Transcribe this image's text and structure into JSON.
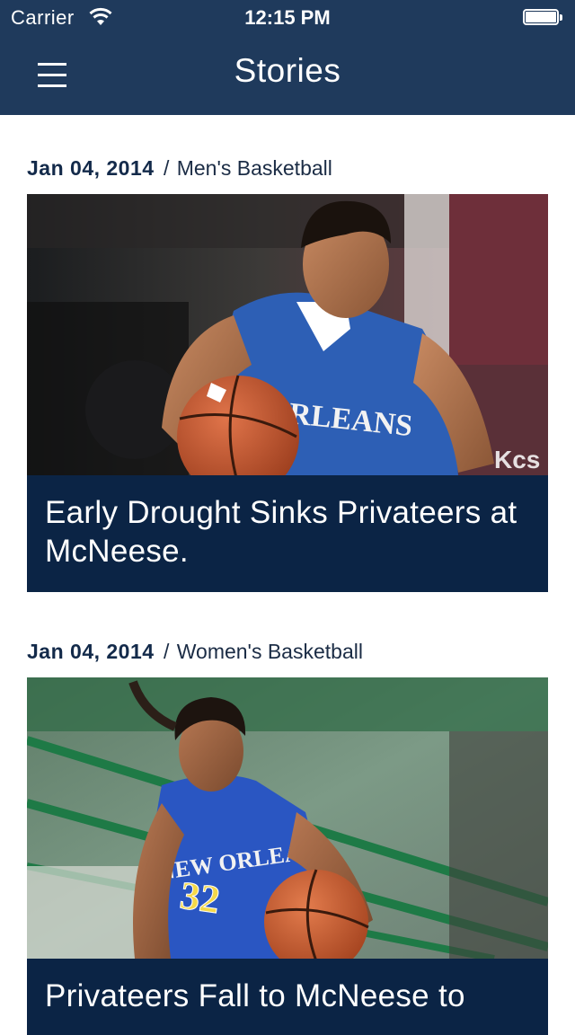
{
  "status_bar": {
    "carrier": "Carrier",
    "time": "12:15 PM",
    "wifi_icon": "wifi-icon",
    "battery_icon": "battery-icon"
  },
  "nav": {
    "title": "Stories",
    "menu_icon": "hamburger-menu-icon"
  },
  "colors": {
    "nav_background": "#1f3a5c",
    "headline_background": "#0b2445",
    "date_text": "#132a4a"
  },
  "stories": [
    {
      "date": "Jan 04, 2014",
      "separator": "/",
      "category": "Men's Basketball",
      "headline": "Early Drought Sinks Privateers at McNeese.",
      "jersey_text": "ORLEANS",
      "photo_subject": "men-basketball-player-photo"
    },
    {
      "date": "Jan 04, 2014",
      "separator": "/",
      "category": "Women's Basketball",
      "headline": "Privateers Fall to McNeese to",
      "jersey_text": "NEW ORLEANS",
      "jersey_number": "32",
      "photo_subject": "women-basketball-player-photo"
    }
  ]
}
